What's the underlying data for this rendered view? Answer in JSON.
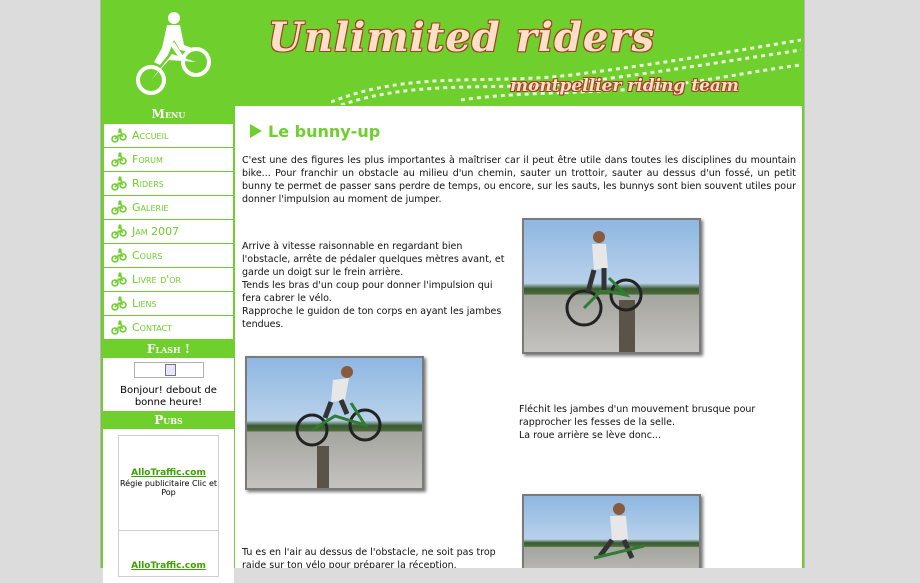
{
  "header": {
    "title": "Unlimited riders",
    "subtitle": "montpellier riding team"
  },
  "sidebar": {
    "menu_heading": "Menu",
    "items": [
      {
        "label": "Accueil"
      },
      {
        "label": "Forum"
      },
      {
        "label": "Riders"
      },
      {
        "label": "Galerie"
      },
      {
        "label": "Jam 2007"
      },
      {
        "label": "Cours"
      },
      {
        "label": "Livre d'or"
      },
      {
        "label": "Liens"
      },
      {
        "label": "Contact"
      }
    ],
    "flash_heading": "Flash !",
    "flash_text": "Bonjour! debout de bonne heure!",
    "pubs_heading": "Pubs",
    "ads": [
      {
        "link": "AlloTraffic.com",
        "text": "Régie publicitaire Clic et Pop"
      },
      {
        "link": "AlloTraffic.com",
        "text": ""
      }
    ]
  },
  "article": {
    "title": "Le bunny-up",
    "intro": "C'est une des figures les plus importantes à maîtriser car il peut être utile dans toutes les disciplines du mountain bike... Pour franchir un obstacle au milieu d'un chemin, sauter un trottoir, sauter au dessus d'un fossé, un petit bunny te permet de passer sans perdre de temps, ou encore, sur les sauts, les bunnys sont bien souvent utiles pour donner l'impulsion au moment de jumper.",
    "step1": "Arrive à vitesse raisonnable en regardant bien l'obstacle, arrête de pédaler quelques mètres avant, et garde un doigt sur le frein arrière.\nTends les bras d'un coup pour donner l'impulsion qui fera cabrer le vélo.\nRapproche le guidon de ton corps en ayant les jambes tendues.",
    "step2": "Fléchit les jambes d'un mouvement brusque pour rapprocher les fesses de la selle.\nLa roue arrière se lève donc...",
    "step3": "Tu es en l'air au dessus de l'obstacle, ne soit pas trop raide sur ton vélo pour préparer la réception."
  },
  "colors": {
    "brand_green": "#6fcf2c",
    "title_fill": "#ffe1c8",
    "title_outline": "#a63a22"
  },
  "icons": {
    "logo": "cyclist-logo-icon",
    "menu_bullet": "bike-icon",
    "flash": "broken-image-icon"
  }
}
